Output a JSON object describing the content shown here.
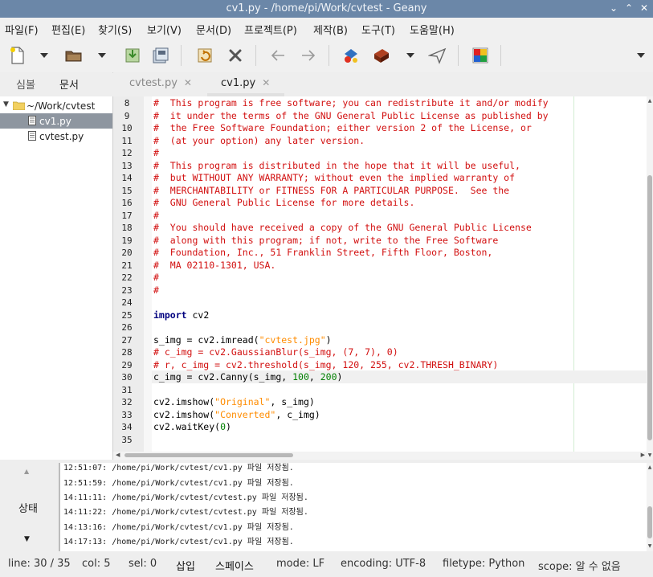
{
  "window": {
    "title": "cv1.py - /home/pi/Work/cvtest - Geany",
    "minimize_glyph": "⌄",
    "maximize_glyph": "⌃",
    "close_glyph": "✕"
  },
  "menu": [
    "파일(F)",
    "편집(E)",
    "찾기(S)",
    "보기(V)",
    "문서(D)",
    "프로젝트(P)",
    "제작(B)",
    "도구(T)",
    "도움말(H)"
  ],
  "toolbar_icons": [
    "new-file-icon",
    "open-file-icon",
    "save-icon",
    "save-all-icon",
    "revert-icon",
    "close-file-icon",
    "back-arrow-icon",
    "forward-arrow-icon",
    "compile-icon",
    "build-icon",
    "execute-icon",
    "color-chooser-icon"
  ],
  "sidebar": {
    "tabs": [
      "심볼",
      "문서"
    ],
    "active_tab": "문서",
    "folder": "~/Work/cvtest",
    "files": [
      "cv1.py",
      "cvtest.py"
    ],
    "selected_file": "cv1.py"
  },
  "editor": {
    "tabs": [
      {
        "label": "cvtest.py",
        "close": "✕",
        "active": false
      },
      {
        "label": "cv1.py",
        "close": "✕",
        "active": true
      }
    ],
    "current_line": 30,
    "lines": [
      {
        "n": "8",
        "parts": [
          {
            "t": "#  This program is free software; you can redistribute it and/or modify",
            "c": "comment"
          }
        ]
      },
      {
        "n": "9",
        "parts": [
          {
            "t": "#  it under the terms of the GNU General Public License as published by",
            "c": "comment"
          }
        ]
      },
      {
        "n": "10",
        "parts": [
          {
            "t": "#  the Free Software Foundation; either version 2 of the License, or",
            "c": "comment"
          }
        ]
      },
      {
        "n": "11",
        "parts": [
          {
            "t": "#  (at your option) any later version.",
            "c": "comment"
          }
        ]
      },
      {
        "n": "12",
        "parts": [
          {
            "t": "#",
            "c": "comment"
          }
        ]
      },
      {
        "n": "13",
        "parts": [
          {
            "t": "#  This program is distributed in the hope that it will be useful,",
            "c": "comment"
          }
        ]
      },
      {
        "n": "14",
        "parts": [
          {
            "t": "#  but WITHOUT ANY WARRANTY; without even the implied warranty of",
            "c": "comment"
          }
        ]
      },
      {
        "n": "15",
        "parts": [
          {
            "t": "#  MERCHANTABILITY or FITNESS FOR A PARTICULAR PURPOSE.  See the",
            "c": "comment"
          }
        ]
      },
      {
        "n": "16",
        "parts": [
          {
            "t": "#  GNU General Public License for more details.",
            "c": "comment"
          }
        ]
      },
      {
        "n": "17",
        "parts": [
          {
            "t": "#",
            "c": "comment"
          }
        ]
      },
      {
        "n": "18",
        "parts": [
          {
            "t": "#  You should have received a copy of the GNU General Public License",
            "c": "comment"
          }
        ]
      },
      {
        "n": "19",
        "parts": [
          {
            "t": "#  along with this program; if not, write to the Free Software",
            "c": "comment"
          }
        ]
      },
      {
        "n": "20",
        "parts": [
          {
            "t": "#  Foundation, Inc., 51 Franklin Street, Fifth Floor, Boston,",
            "c": "comment"
          }
        ]
      },
      {
        "n": "21",
        "parts": [
          {
            "t": "#  MA 02110-1301, USA.",
            "c": "comment"
          }
        ]
      },
      {
        "n": "22",
        "parts": [
          {
            "t": "#",
            "c": "comment"
          }
        ]
      },
      {
        "n": "23",
        "parts": [
          {
            "t": "#",
            "c": "comment"
          }
        ]
      },
      {
        "n": "24",
        "parts": []
      },
      {
        "n": "25",
        "parts": [
          {
            "t": "import",
            "c": "kw"
          },
          {
            "t": " cv2",
            "c": ""
          }
        ]
      },
      {
        "n": "26",
        "parts": []
      },
      {
        "n": "27",
        "parts": [
          {
            "t": "s_img = cv2.imread(",
            "c": ""
          },
          {
            "t": "\"cvtest.jpg\"",
            "c": "str"
          },
          {
            "t": ")",
            "c": ""
          }
        ]
      },
      {
        "n": "28",
        "parts": [
          {
            "t": "# c_img = cv2.GaussianBlur(s_img, (7, 7), 0)",
            "c": "comment"
          }
        ]
      },
      {
        "n": "29",
        "parts": [
          {
            "t": "# r, c_img = cv2.threshold(s_img, 120, 255, cv2.THRESH_BINARY)",
            "c": "comment"
          }
        ]
      },
      {
        "n": "30",
        "parts": [
          {
            "t": "c_img = cv2.Canny(s_img, ",
            "c": ""
          },
          {
            "t": "100",
            "c": "num"
          },
          {
            "t": ", ",
            "c": ""
          },
          {
            "t": "200",
            "c": "num"
          },
          {
            "t": ")",
            "c": ""
          }
        ]
      },
      {
        "n": "31",
        "parts": []
      },
      {
        "n": "32",
        "parts": [
          {
            "t": "cv2.imshow(",
            "c": ""
          },
          {
            "t": "\"Original\"",
            "c": "str"
          },
          {
            "t": ", s_img)",
            "c": ""
          }
        ]
      },
      {
        "n": "33",
        "parts": [
          {
            "t": "cv2.imshow(",
            "c": ""
          },
          {
            "t": "\"Converted\"",
            "c": "str"
          },
          {
            "t": ", c_img)",
            "c": ""
          }
        ]
      },
      {
        "n": "34",
        "parts": [
          {
            "t": "cv2.waitKey(",
            "c": ""
          },
          {
            "t": "0",
            "c": "num"
          },
          {
            "t": ")",
            "c": ""
          }
        ]
      },
      {
        "n": "35",
        "parts": []
      }
    ]
  },
  "messages": {
    "tab_label": "상태",
    "up_glyph": "▲",
    "down_glyph": "▼",
    "lines": [
      "12:51:07: /home/pi/Work/cvtest/cv1.py 파일 저장됨.",
      "12:51:59: /home/pi/Work/cvtest/cv1.py 파일 저장됨.",
      "14:11:11: /home/pi/Work/cvtest/cvtest.py 파일 저장됨.",
      "14:11:22: /home/pi/Work/cvtest/cvtest.py 파일 저장됨.",
      "14:13:16: /home/pi/Work/cvtest/cv1.py 파일 저장됨.",
      "14:17:13: /home/pi/Work/cvtest/cv1.py 파일 저장됨."
    ]
  },
  "status": {
    "line": "line: 30 / 35",
    "col": "col: 5",
    "sel": "sel: 0",
    "insert": "삽입",
    "indent": "스페이스",
    "mode": "mode: LF",
    "encoding": "encoding: UTF-8",
    "filetype": "filetype: Python",
    "scope": "scope: 알 수 없음"
  },
  "colors": {
    "titlebar": "#6b87a8",
    "comment": "#d21010",
    "keyword": "#00007f",
    "string": "#ff8c00",
    "number": "#007f00",
    "selected_row": "#8e96a0"
  }
}
